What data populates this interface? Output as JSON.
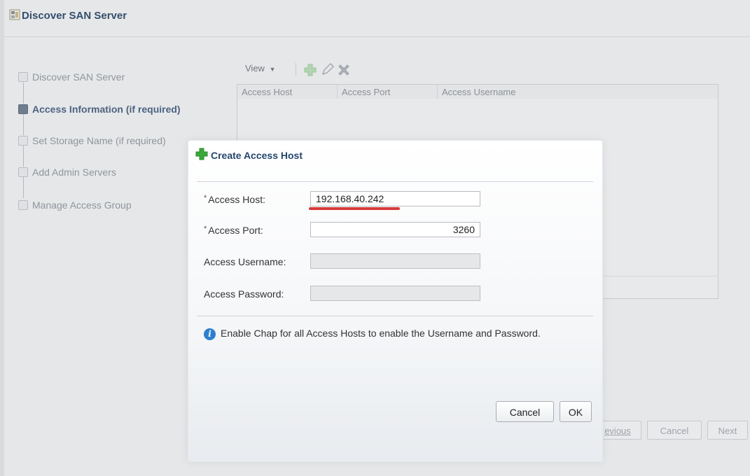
{
  "window": {
    "title": "Discover SAN Server"
  },
  "train": {
    "steps": [
      {
        "label": "Discover SAN Server",
        "state": "visited"
      },
      {
        "label": "Access Information (if required)",
        "state": "current"
      },
      {
        "label": "Set Storage Name (if required)",
        "state": "pending"
      },
      {
        "label": "Add Admin Servers",
        "state": "pending"
      },
      {
        "label": "Manage Access Group",
        "state": "pending"
      }
    ]
  },
  "table": {
    "view_menu": "View",
    "columns": [
      "Access Host",
      "Access Port",
      "Access Username"
    ],
    "icons": [
      "add-icon",
      "edit-icon",
      "delete-icon"
    ]
  },
  "wizard_buttons": {
    "previous": "Previous",
    "previous_visible": "evious",
    "cancel": "Cancel",
    "next": "Next"
  },
  "dialog": {
    "title": "Create Access Host",
    "required_marker": "*",
    "fields": {
      "access_host": {
        "label": "Access Host:",
        "value": "192.168.40.242",
        "required": true
      },
      "access_port": {
        "label": "Access Port:",
        "value": "3260",
        "required": true
      },
      "access_username": {
        "label": "Access Username:",
        "value": "",
        "enabled": false
      },
      "access_password": {
        "label": "Access Password:",
        "value": "",
        "enabled": false
      }
    },
    "info_text": "Enable Chap for all Access Hosts to enable the Username and Password.",
    "cancel_label": "Cancel",
    "ok_label": "OK"
  },
  "colors": {
    "dialog_title": "#24466e",
    "add_icon_green": "#3aa838",
    "info_blue": "#2f7fd0",
    "annotation_red": "#d83a3a"
  }
}
